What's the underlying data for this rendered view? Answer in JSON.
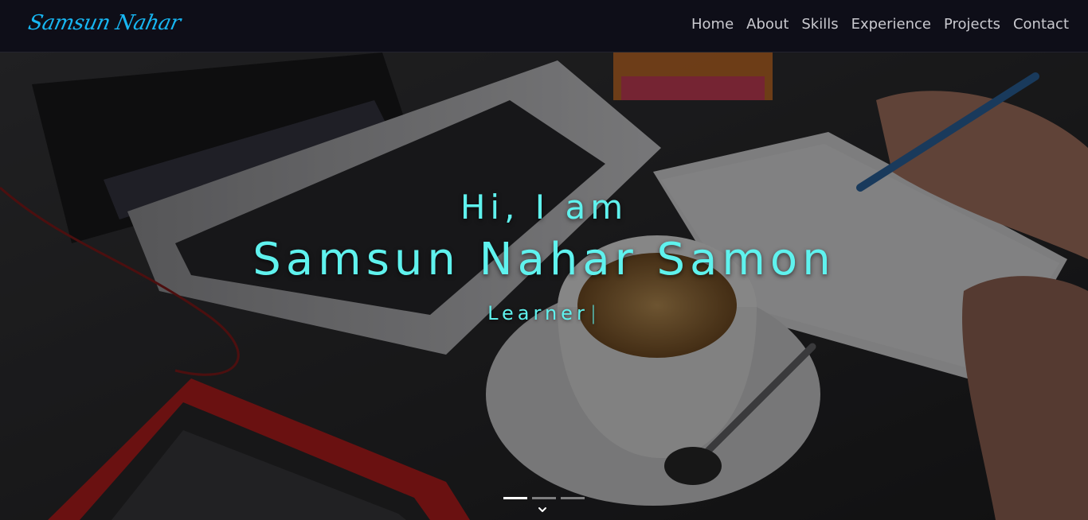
{
  "navbar": {
    "brand": "Samsun Nahar",
    "links": [
      "Home",
      "About",
      "Skills",
      "Experience",
      "Projects",
      "Contact"
    ]
  },
  "hero": {
    "greeting": "Hi, I am",
    "name": "Samsun Nahar Samon",
    "role": "Learner",
    "cursor": "|",
    "slide_count": 3,
    "active_slide": 1
  },
  "colors": {
    "brand": "#17b6f2",
    "accent": "#5ff2ee",
    "navbar_bg": "#0e0e18",
    "nav_text": "#c9c9cf"
  },
  "icons": {
    "scroll": "chevron-down-icon"
  }
}
